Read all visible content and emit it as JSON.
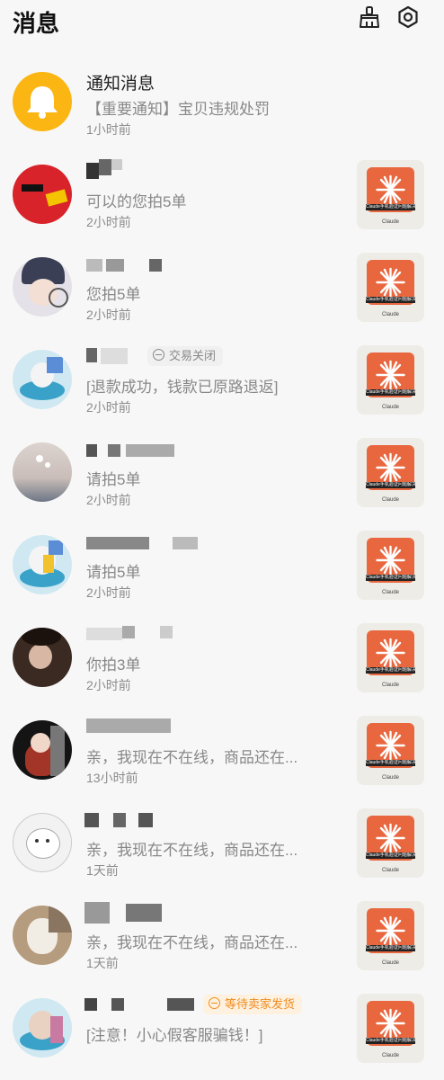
{
  "header": {
    "title": "消息",
    "clean_icon": "broom-icon",
    "settings_icon": "gear-icon"
  },
  "thumb": {
    "caption": "Claude手机验证问题解决",
    "brand": "Claude"
  },
  "messages": [
    {
      "name": "通知消息",
      "preview": "【重要通知】宝贝违规处罚",
      "time": "1小时前"
    },
    {
      "name": "",
      "preview": "可以的您拍5单",
      "time": "2小时前"
    },
    {
      "name": "",
      "preview": "您拍5单",
      "time": "2小时前"
    },
    {
      "name": "",
      "preview": "[退款成功，钱款已原路退返]",
      "time": "2小时前",
      "tag": "交易关闭"
    },
    {
      "name": "",
      "preview": "请拍5单",
      "time": "2小时前"
    },
    {
      "name": "",
      "preview": "请拍5单",
      "time": "2小时前"
    },
    {
      "name": "",
      "preview": "你拍3单",
      "time": "2小时前"
    },
    {
      "name": "",
      "preview": "亲，我现在不在线，商品还在...",
      "time": "13小时前"
    },
    {
      "name": "",
      "preview": "亲，我现在不在线，商品还在...",
      "time": "1天前"
    },
    {
      "name": "",
      "preview": "亲，我现在不在线，商品还在...",
      "time": "1天前"
    },
    {
      "name": "",
      "preview": "[注意！小心假客服骗钱！]",
      "time": "",
      "tag": "等待卖家发货"
    }
  ],
  "colors": {
    "accent": "#f08c1e",
    "bell": "#fbb613",
    "claude": "#e8673f"
  }
}
